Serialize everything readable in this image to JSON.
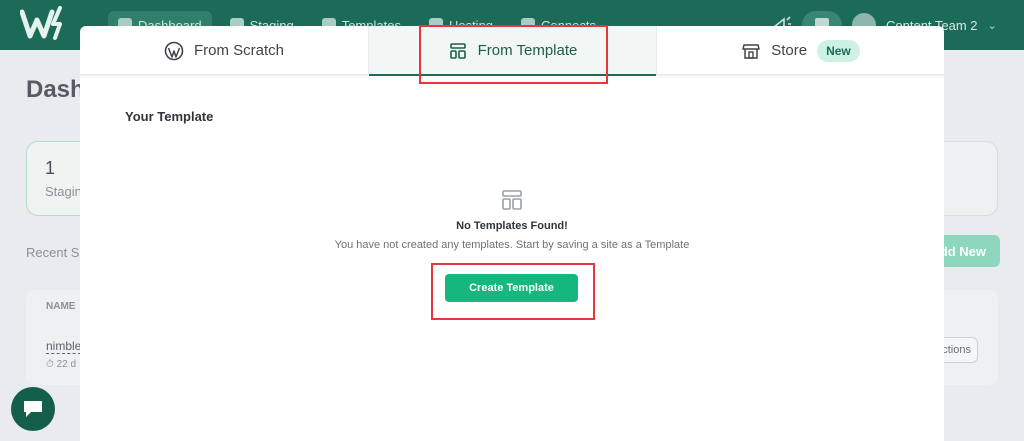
{
  "topbar": {
    "nav": [
      "Dashboard",
      "Staging",
      "Templates",
      "Hosting",
      "Connects"
    ],
    "team": "Content Team 2"
  },
  "background": {
    "page_title": "Dash",
    "stat_number": "1",
    "stat_label": "Stagin",
    "recent_label": "Recent S",
    "add_new_label": "dd New",
    "table_header_name": "NAME",
    "row_name": "nimble",
    "row_meta": "22 d",
    "actions_label": "ctions"
  },
  "modal": {
    "tabs": [
      {
        "label": "From Scratch",
        "icon": "wordpress-icon",
        "active": false
      },
      {
        "label": "From Template",
        "icon": "template-icon",
        "active": true
      },
      {
        "label": "Store",
        "icon": "store-icon",
        "active": false,
        "badge": "New"
      }
    ],
    "section_title": "Your Template",
    "empty_title": "No Templates Found!",
    "empty_description": "You have not created any templates. Start by saving a site as a Template",
    "create_button": "Create Template"
  },
  "colors": {
    "brand": "#1c6b58",
    "button": "#16b67f",
    "annotation": "#e8373b"
  }
}
